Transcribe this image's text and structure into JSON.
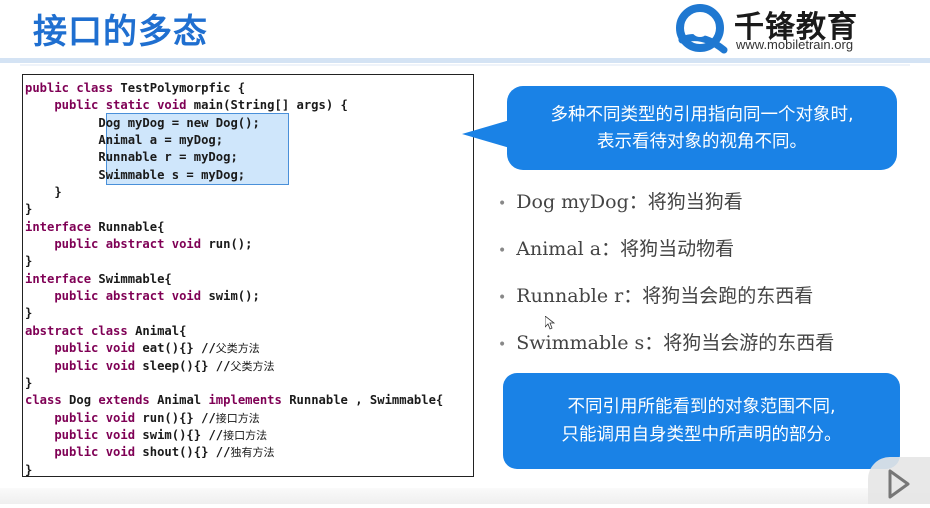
{
  "slide": {
    "title": "接口的多态",
    "logo_name": "千锋教育",
    "logo_url": "www.mobiletrain.org"
  },
  "code": {
    "lines": [
      [
        {
          "t": "public class ",
          "k": true
        },
        {
          "t": "TestPolymorpfic {"
        }
      ],
      [
        {
          "t": "    public static void ",
          "k": true
        },
        {
          "t": "main(String[] args) {"
        }
      ],
      [
        {
          "t": "          Dog myDog = new Dog();"
        }
      ],
      [
        {
          "t": "          Animal a = myDog;"
        }
      ],
      [
        {
          "t": "          Runnable r = myDog;"
        }
      ],
      [
        {
          "t": "          Swimmable s = myDog;"
        }
      ],
      [
        {
          "t": "    }"
        }
      ],
      [
        {
          "t": "}"
        }
      ],
      [
        {
          "t": "interface ",
          "k": true
        },
        {
          "t": "Runnable{"
        }
      ],
      [
        {
          "t": "    public abstract void ",
          "k": true
        },
        {
          "t": "run();"
        }
      ],
      [
        {
          "t": "}"
        }
      ],
      [
        {
          "t": "interface ",
          "k": true
        },
        {
          "t": "Swimmable{"
        }
      ],
      [
        {
          "t": "    public abstract void ",
          "k": true
        },
        {
          "t": "swim();"
        }
      ],
      [
        {
          "t": "}"
        }
      ],
      [
        {
          "t": "abstract class ",
          "k": true
        },
        {
          "t": "Animal{"
        }
      ],
      [
        {
          "t": "    public void ",
          "k": true
        },
        {
          "t": "eat(){} //"
        },
        {
          "t": "父类方法",
          "c": true
        }
      ],
      [
        {
          "t": "    public void ",
          "k": true
        },
        {
          "t": "sleep(){} //"
        },
        {
          "t": "父类方法",
          "c": true
        }
      ],
      [
        {
          "t": "}"
        }
      ],
      [
        {
          "t": "class ",
          "k": true
        },
        {
          "t": "Dog "
        },
        {
          "t": "extends ",
          "k": true
        },
        {
          "t": "Animal "
        },
        {
          "t": "implements ",
          "k": true
        },
        {
          "t": "Runnable , Swimmable{"
        }
      ],
      [
        {
          "t": "    public void ",
          "k": true
        },
        {
          "t": "run(){} //"
        },
        {
          "t": "接口方法",
          "c": true
        }
      ],
      [
        {
          "t": "    public void ",
          "k": true
        },
        {
          "t": "swim(){} //"
        },
        {
          "t": "接口方法",
          "c": true
        }
      ],
      [
        {
          "t": "    public void ",
          "k": true
        },
        {
          "t": "shout(){} //"
        },
        {
          "t": "独有方法",
          "c": true
        }
      ],
      [
        {
          "t": "}"
        }
      ]
    ]
  },
  "callout_top": {
    "line1": "多种不同类型的引用指向同一个对象时,",
    "line2": "表示看待对象的视角不同。"
  },
  "bullets": [
    "Dog myDog：将狗当狗看",
    "Animal a：将狗当动物看",
    "Runnable r：将狗当会跑的东西看",
    "Swimmable s：将狗当会游的东西看"
  ],
  "callout_bottom": {
    "line1": "不同引用所能看到的对象范围不同,",
    "line2": "只能调用自身类型中所声明的部分。"
  },
  "colors": {
    "title": "#1f6fd0",
    "callout": "#1a82e6",
    "highlight": "#cfe6fb",
    "keyword": "#7f0055"
  }
}
